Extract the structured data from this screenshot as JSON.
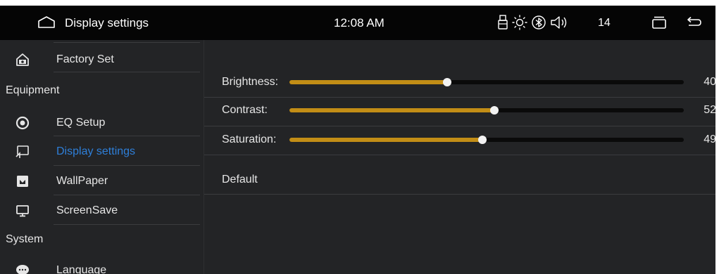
{
  "header": {
    "title": "Display settings",
    "time": "12:08 AM",
    "volume": "14",
    "icons": [
      "home-icon",
      "usb-icon",
      "brightness-icon",
      "bluetooth-icon",
      "speaker-icon",
      "recent-apps-icon",
      "back-icon"
    ]
  },
  "sidebar": {
    "items": [
      {
        "label": "Factory Set",
        "icon": "factory-icon"
      },
      {
        "label": "Equipment",
        "type": "section"
      },
      {
        "label": "EQ Setup",
        "icon": "eq-icon"
      },
      {
        "label": "Display settings",
        "icon": "display-icon",
        "active": true
      },
      {
        "label": "WallPaper",
        "icon": "wallpaper-icon"
      },
      {
        "label": "ScreenSave",
        "icon": "monitor-icon"
      },
      {
        "label": "System",
        "type": "section"
      },
      {
        "label": "Language",
        "icon": "chat-icon"
      }
    ]
  },
  "settings": {
    "brightness": {
      "label": "Brightness:",
      "value": "40",
      "level": 40
    },
    "contrast": {
      "label": "Contrast:",
      "value": "52",
      "level": 52
    },
    "saturation": {
      "label": "Saturation:",
      "value": "49",
      "level": 49
    },
    "default_label": "Default"
  },
  "colors": {
    "accent": "#c28d16",
    "active_text": "#2e7fd9",
    "background": "#232426",
    "topbar": "#050505"
  }
}
